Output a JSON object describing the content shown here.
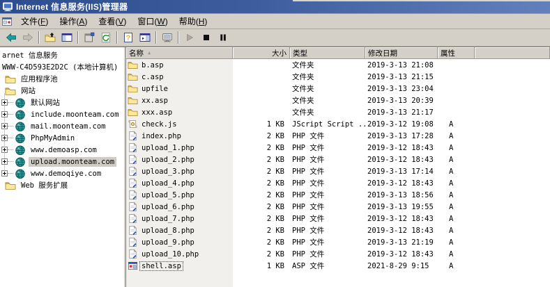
{
  "window": {
    "title": "Internet 信息服务(IIS)管理器"
  },
  "menu": {
    "items": [
      {
        "name": "file",
        "label": "文件(F)"
      },
      {
        "name": "action",
        "label": "操作(A)"
      },
      {
        "name": "view",
        "label": "查看(V)"
      },
      {
        "name": "window",
        "label": "窗口(W)"
      },
      {
        "name": "help",
        "label": "帮助(H)"
      }
    ]
  },
  "toolbar": {
    "buttons": [
      {
        "name": "back",
        "icon": "back-icon",
        "disabled": false
      },
      {
        "name": "forward",
        "icon": "forward-icon",
        "disabled": true
      },
      {
        "separator": true
      },
      {
        "name": "up-folder",
        "icon": "up-folder-icon",
        "disabled": false
      },
      {
        "name": "show-console-tree",
        "icon": "console-tree-icon",
        "disabled": false
      },
      {
        "separator": true
      },
      {
        "name": "properties",
        "icon": "properties-icon",
        "disabled": false
      },
      {
        "name": "refresh",
        "icon": "refresh-icon",
        "disabled": false
      },
      {
        "separator": true
      },
      {
        "name": "help",
        "icon": "help-icon",
        "disabled": false
      },
      {
        "name": "show-detail-pane",
        "icon": "detail-pane-icon",
        "disabled": false
      },
      {
        "separator": true
      },
      {
        "name": "computer",
        "icon": "computer-icon",
        "disabled": true
      },
      {
        "separator": true
      },
      {
        "name": "start-site",
        "icon": "play-icon",
        "disabled": true
      },
      {
        "name": "stop-site",
        "icon": "stop-icon",
        "disabled": false
      },
      {
        "name": "pause-site",
        "icon": "pause-icon",
        "disabled": false
      }
    ]
  },
  "tree": {
    "items": [
      {
        "name": "internet-information-services",
        "label": "arnet 信息服务",
        "level": 0,
        "icon": "",
        "expandable": false,
        "selected": false
      },
      {
        "name": "local-computer",
        "label": "WWW-C4D593E2D2C (本地计算机)",
        "level": 0,
        "icon": "",
        "expandable": false,
        "selected": false
      },
      {
        "name": "application-pools",
        "label": "应用程序池",
        "level": 1,
        "icon": "folder-icon",
        "expandable": false,
        "selected": false
      },
      {
        "name": "web-sites",
        "label": "网站",
        "level": 1,
        "icon": "folder-icon",
        "expandable": false,
        "selected": false
      },
      {
        "name": "default-web-site",
        "label": "默认网站",
        "level": 2,
        "icon": "globe-icon",
        "expandable": true,
        "selected": false
      },
      {
        "name": "include-moonteam-com",
        "label": "include.moonteam.com",
        "level": 2,
        "icon": "globe-icon",
        "expandable": true,
        "selected": false
      },
      {
        "name": "mail-moonteam-com",
        "label": "mail.moonteam.com",
        "level": 2,
        "icon": "globe-icon",
        "expandable": true,
        "selected": false
      },
      {
        "name": "phpmyadmin",
        "label": "PhpMyAdmin",
        "level": 2,
        "icon": "globe-icon",
        "expandable": true,
        "selected": false
      },
      {
        "name": "www-demoasp-com",
        "label": "www.demoasp.com",
        "level": 2,
        "icon": "globe-icon",
        "expandable": true,
        "selected": false
      },
      {
        "name": "upload-moonteam-com",
        "label": "upload.moonteam.com",
        "level": 2,
        "icon": "globe-icon",
        "expandable": true,
        "selected": true
      },
      {
        "name": "www-demoqiye-com",
        "label": "www.demoqiye.com",
        "level": 2,
        "icon": "globe-icon",
        "expandable": true,
        "selected": false
      },
      {
        "name": "web-service-extensions",
        "label": "Web 服务扩展",
        "level": 1,
        "icon": "folder-icon",
        "expandable": false,
        "selected": false
      }
    ]
  },
  "list": {
    "columns": [
      {
        "key": "name",
        "label": "名称",
        "sorted": "asc",
        "align": "left"
      },
      {
        "key": "size",
        "label": "大小",
        "sorted": "",
        "align": "right"
      },
      {
        "key": "type",
        "label": "类型",
        "sorted": "",
        "align": "left"
      },
      {
        "key": "modified",
        "label": "修改日期",
        "sorted": "",
        "align": "left"
      },
      {
        "key": "attr",
        "label": "属性",
        "sorted": "",
        "align": "left"
      },
      {
        "key": "filler",
        "label": "",
        "sorted": "",
        "align": "left"
      }
    ],
    "rows": [
      {
        "icon": "folder-icon",
        "name": "b.asp",
        "size": "",
        "type": "文件夹",
        "modified": "2019-3-13 21:08",
        "attr": "",
        "focused": false
      },
      {
        "icon": "folder-icon",
        "name": "c.asp",
        "size": "",
        "type": "文件夹",
        "modified": "2019-3-13 21:15",
        "attr": "",
        "focused": false
      },
      {
        "icon": "folder-icon",
        "name": "upfile",
        "size": "",
        "type": "文件夹",
        "modified": "2019-3-13 23:04",
        "attr": "",
        "focused": false
      },
      {
        "icon": "folder-icon",
        "name": "xx.asp",
        "size": "",
        "type": "文件夹",
        "modified": "2019-3-13 20:39",
        "attr": "",
        "focused": false
      },
      {
        "icon": "folder-icon",
        "name": "xxx.asp",
        "size": "",
        "type": "文件夹",
        "modified": "2019-3-13 21:17",
        "attr": "",
        "focused": false
      },
      {
        "icon": "jscript-icon",
        "name": "check.js",
        "size": "1 KB",
        "type": "JScript Script ...",
        "modified": "2019-3-12 19:08",
        "attr": "A",
        "focused": false
      },
      {
        "icon": "php-file-icon",
        "name": "index.php",
        "size": "2 KB",
        "type": "PHP 文件",
        "modified": "2019-3-13 17:28",
        "attr": "A",
        "focused": false
      },
      {
        "icon": "php-file-icon",
        "name": "upload_1.php",
        "size": "2 KB",
        "type": "PHP 文件",
        "modified": "2019-3-12 18:43",
        "attr": "A",
        "focused": false
      },
      {
        "icon": "php-file-icon",
        "name": "upload_2.php",
        "size": "2 KB",
        "type": "PHP 文件",
        "modified": "2019-3-12 18:43",
        "attr": "A",
        "focused": false
      },
      {
        "icon": "php-file-icon",
        "name": "upload_3.php",
        "size": "2 KB",
        "type": "PHP 文件",
        "modified": "2019-3-13 17:14",
        "attr": "A",
        "focused": false
      },
      {
        "icon": "php-file-icon",
        "name": "upload_4.php",
        "size": "2 KB",
        "type": "PHP 文件",
        "modified": "2019-3-12 18:43",
        "attr": "A",
        "focused": false
      },
      {
        "icon": "php-file-icon",
        "name": "upload_5.php",
        "size": "2 KB",
        "type": "PHP 文件",
        "modified": "2019-3-13 18:56",
        "attr": "A",
        "focused": false
      },
      {
        "icon": "php-file-icon",
        "name": "upload_6.php",
        "size": "2 KB",
        "type": "PHP 文件",
        "modified": "2019-3-13 19:55",
        "attr": "A",
        "focused": false
      },
      {
        "icon": "php-file-icon",
        "name": "upload_7.php",
        "size": "2 KB",
        "type": "PHP 文件",
        "modified": "2019-3-12 18:43",
        "attr": "A",
        "focused": false
      },
      {
        "icon": "php-file-icon",
        "name": "upload_8.php",
        "size": "2 KB",
        "type": "PHP 文件",
        "modified": "2019-3-12 18:43",
        "attr": "A",
        "focused": false
      },
      {
        "icon": "php-file-icon",
        "name": "upload_9.php",
        "size": "2 KB",
        "type": "PHP 文件",
        "modified": "2019-3-13 21:19",
        "attr": "A",
        "focused": false
      },
      {
        "icon": "php-file-icon",
        "name": "upload_10.php",
        "size": "2 KB",
        "type": "PHP 文件",
        "modified": "2019-3-12 18:43",
        "attr": "A",
        "focused": false
      },
      {
        "icon": "asp-file-icon",
        "name": "shell.asp",
        "size": "1 KB",
        "type": "ASP 文件",
        "modified": "2021-8-29 9:15",
        "attr": "A",
        "focused": true
      }
    ]
  },
  "colors": {
    "titlebar_start": "#2c4d8e",
    "titlebar_end": "#6480bb",
    "chrome": "#d4d0c8",
    "sorted_column_tint": "#f2f0ed",
    "tree_selection": "#cfccc4"
  }
}
